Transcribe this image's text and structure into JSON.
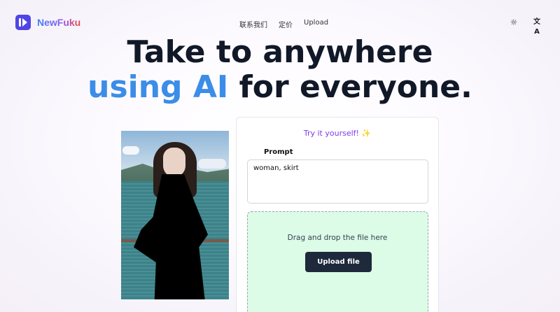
{
  "header": {
    "brand": "NewFuku",
    "nav": [
      "联系我们",
      "定价",
      "Upload"
    ],
    "icons": [
      "sun-icon",
      "translate-icon"
    ]
  },
  "hero": {
    "line1": "Take to anywhere",
    "line2_accent": "using AI",
    "line2_rest": " for everyone."
  },
  "tool": {
    "try_label": "Try it yourself! ✨",
    "prompt_label": "Prompt",
    "prompt_value": "woman, skirt",
    "drop_text": "Drag and drop the file here",
    "upload_button": "Upload file"
  },
  "colors": {
    "accent": "#3b8de8",
    "brand": "#4f46e5",
    "try_label": "#7c3aed",
    "dropzone_bg": "#dcfce7",
    "button_bg": "#1e293b"
  }
}
